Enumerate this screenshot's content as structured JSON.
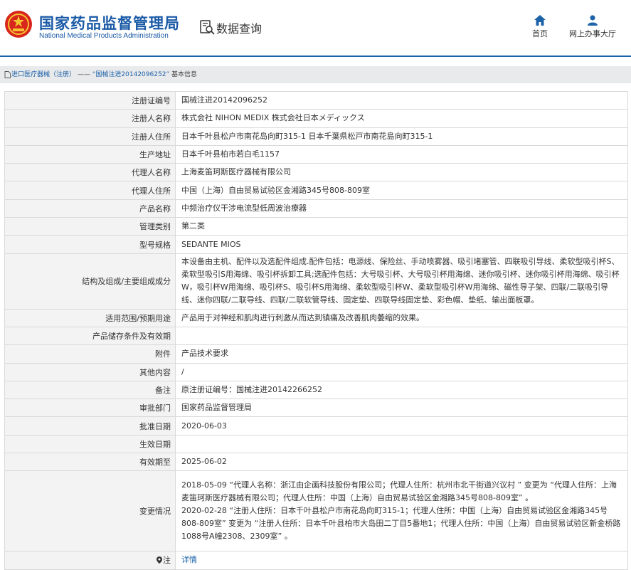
{
  "header": {
    "logo_cn": "国家药品监督管理局",
    "logo_en": "National Medical Products Administration",
    "page_title": "数据查询",
    "nav": [
      {
        "label": "首页",
        "icon": "home-icon"
      },
      {
        "label": "网上办事大厅",
        "icon": "user-icon"
      }
    ],
    "brand_color": "#1a5aa6"
  },
  "breadcrumb": {
    "category": "进口医疗器械（注册）",
    "separator": "——",
    "record": "“国械注进20142096252”",
    "section": "基本信息"
  },
  "details": {
    "rows": [
      {
        "label": "注册证编号",
        "value": "国械注进20142096252"
      },
      {
        "label": "注册人名称",
        "value": "株式会社 NIHON MEDIX 株式会社日本メディックス"
      },
      {
        "label": "注册人住所",
        "value": "日本千叶县松户市南花岛向町315-1 日本千葉県松戸市南花島向町315-1"
      },
      {
        "label": "生产地址",
        "value": "日本千叶县柏市若白毛1157"
      },
      {
        "label": "代理人名称",
        "value": "上海麦笛珂斯医疗器械有限公司"
      },
      {
        "label": "代理人住所",
        "value": "中国（上海）自由贸易试验区金湘路345号808-809室"
      },
      {
        "label": "产品名称",
        "value": "中频治疗仪干涉电流型低周波治療器"
      },
      {
        "label": "管理类别",
        "value": "第二类"
      },
      {
        "label": "型号规格",
        "value": "SEDANTE MIOS"
      },
      {
        "label": "结构及组成/主要组成成分",
        "value": "本设备由主机、配件以及选配件组成.配件包括：电源线、保险丝、手动喷雾器、吸引堵塞管、四联吸引导线、柔软型吸引杯S、柔软型吸引S用海绵、吸引杯拆卸工具;选配件包括：大号吸引杯、大号吸引杯用海绵、迷你吸引杯、迷你吸引杯用海绵、吸引杯W，吸引杯W用海绵、吸引杯S、吸引杯S用海绵、柔软型吸引杯W、柔软型吸引杯W用海绵、磁性导子架、四联/二联吸引导线、迷你四联/二联导线、四联/二联软管导线、固定垫、四联导线固定垫、彩色帽、垫纸、输出面板罩。"
      },
      {
        "label": "适用范围/预期用途",
        "value": "产品用于对神经和肌肉进行刺激从而达到镇痛及改善肌肉萎缩的效果。"
      },
      {
        "label": "产品储存条件及有效期",
        "value": ""
      },
      {
        "label": "附件",
        "value": "产品技术要求"
      },
      {
        "label": "其他内容",
        "value": "/"
      },
      {
        "label": "备注",
        "value": "原注册证编号：国械注进20142266252"
      },
      {
        "label": "审批部门",
        "value": "国家药品监督管理局"
      },
      {
        "label": "批准日期",
        "value": "2020-06-03"
      },
      {
        "label": "生效日期",
        "value": ""
      },
      {
        "label": "有效期至",
        "value": "2025-06-02"
      },
      {
        "label": "变更情况",
        "value": "2018-05-09 “代理人名称：浙江由企画科技股份有限公司；代理人住所：杭州市北干街道兴议村 ” 变更为 “代理人住所：上海麦笛珂斯医疗器械有限公司；代理人住所：中国（上海）自由贸易试验区金湘路345号808-809室” 。\n2020-02-28 “注册人住所：日本千叶县松户市南花岛向町315-1；代理人住所：中国（上海）自由贸易试验区金湘路345号808-809室” 变更为 “注册人住所：日本千叶县柏市大岛田二丁目5番地1；代理人住所：中国（上海）自由贸易试验区新金桥路1088号A幢2308、2309室” 。"
      }
    ],
    "note": {
      "label": "注",
      "link_text": "详情"
    }
  }
}
